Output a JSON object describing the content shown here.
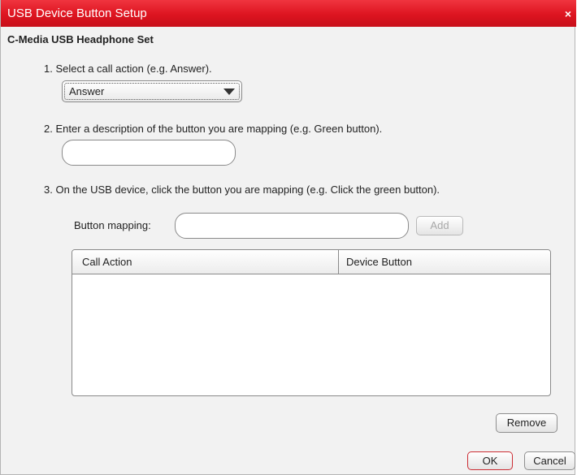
{
  "window": {
    "title": "USB Device Button Setup",
    "close_glyph": "×"
  },
  "device_name": "C-Media USB Headphone Set",
  "steps": {
    "step1": "1. Select a call action (e.g. Answer).",
    "step2": "2. Enter a description of the button you are mapping (e.g. Green button).",
    "step3": "3. On the USB device, click the button you are mapping (e.g. Click the green button)."
  },
  "call_action_select": {
    "value": "Answer"
  },
  "description_input": {
    "value": ""
  },
  "mapping": {
    "label": "Button mapping:",
    "value": "",
    "add_label": "Add"
  },
  "table": {
    "columns": [
      "Call Action",
      "Device Button"
    ],
    "rows": []
  },
  "buttons": {
    "remove": "Remove",
    "ok": "OK",
    "cancel": "Cancel"
  },
  "colors": {
    "titlebar": "#dd1420",
    "ok_border": "#cc2d34",
    "disabled_text": "#a8a8a8"
  },
  "icons": {
    "close": "close-icon",
    "dropdown": "chevron-down-icon"
  }
}
